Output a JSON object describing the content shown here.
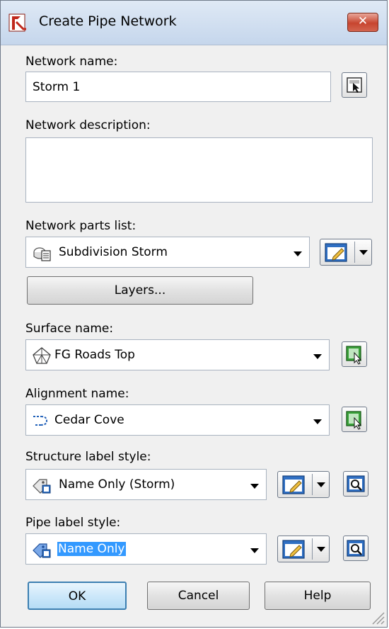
{
  "window": {
    "title": "Create Pipe Network",
    "close_label": "✕"
  },
  "network_name": {
    "label": "Network name:",
    "value": "Storm 1"
  },
  "network_description": {
    "label": "Network description:",
    "value": ""
  },
  "parts_list": {
    "label": "Network parts list:",
    "value": "Subdivision Storm",
    "layers_button": "Layers..."
  },
  "surface": {
    "label": "Surface name:",
    "value": "FG Roads Top"
  },
  "alignment": {
    "label": "Alignment name:",
    "value": "Cedar Cove"
  },
  "structure_label_style": {
    "label": "Structure label style:",
    "value": "Name Only (Storm)"
  },
  "pipe_label_style": {
    "label": "Pipe label style:",
    "value": "Name Only"
  },
  "buttons": {
    "ok": "OK",
    "cancel": "Cancel",
    "help": "Help"
  },
  "colors": {
    "title_gradient_top": "#dfe9f5",
    "close_red": "#c7452f",
    "selection_blue": "#3399ff",
    "default_button_border": "#3c7fb1"
  }
}
